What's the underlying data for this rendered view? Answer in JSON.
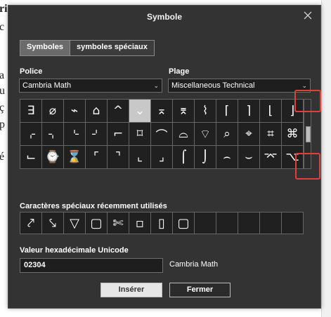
{
  "background_doc": {
    "lines": [
      "ri",
      "c",
      "a",
      "u",
      "ç",
      "p",
      "é"
    ]
  },
  "dialog": {
    "title": "Symbole",
    "tabs": [
      {
        "label": "Symboles",
        "active": true
      },
      {
        "label": "symboles spéciaux",
        "active": false
      }
    ],
    "font": {
      "label": "Police",
      "value": "Cambria Math"
    },
    "range": {
      "label": "Plage",
      "value": "Miscellaneous Technical"
    },
    "symbols": [
      "∃",
      "⌀",
      "⌁",
      "⌂",
      "^",
      "⌄",
      "⌅",
      "⌆",
      "⌇",
      "⌈",
      "⌉",
      "⌊",
      "⌋",
      "⌌",
      "⌍",
      "⌎",
      "⌏",
      "⌐",
      "⌑",
      "⌒",
      "⌓",
      "⌔",
      "⌕",
      "⌖",
      "⌗",
      "⌘",
      "⌙",
      "⌚",
      "⌛",
      "⌜",
      "⌝",
      "⌞",
      "⌟",
      "⌠",
      "⌡",
      "⌢",
      "⌣",
      "⌤",
      "⌥"
    ],
    "selected_symbol_index": 5,
    "recent_label": "Caractères spéciaux récemment utilisés",
    "recent_symbols": [
      "⤤",
      "⤥",
      "▽",
      "▢",
      "✄",
      "▫",
      "▯",
      "▢",
      "",
      "",
      "",
      "",
      ""
    ],
    "unicode_label": "Valeur hexadécimale Unicode",
    "unicode_value": "02304",
    "unicode_font": "Cambria Math",
    "insert_button": "Insérer",
    "close_button": "Fermer"
  },
  "colors": {
    "dialog_bg": "#333333",
    "highlight": "#e0403a",
    "selected_cell": "#c8c8c8"
  }
}
